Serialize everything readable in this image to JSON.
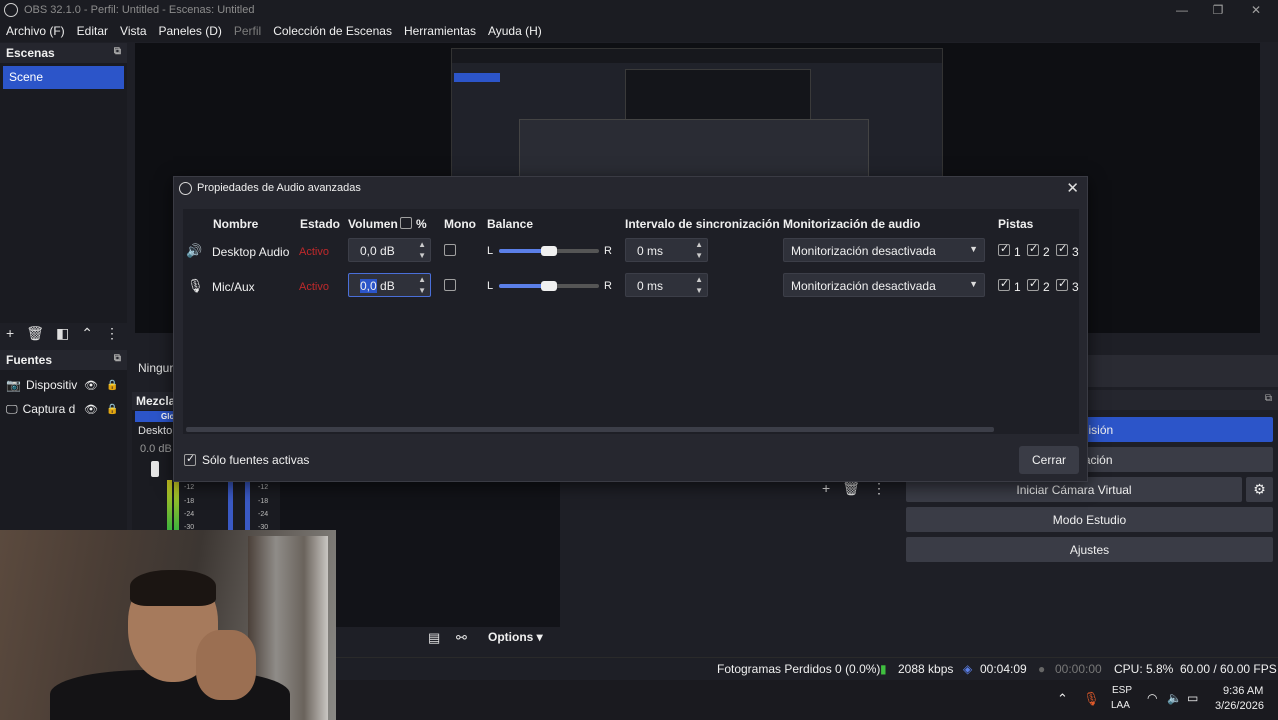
{
  "window": {
    "title": "OBS 32.1.0 - Perfil: Untitled - Escenas: Untitled",
    "controls": {
      "minimize": "—",
      "maximize": "❐",
      "close": "✕"
    }
  },
  "menu": {
    "items": [
      "Archivo (F)",
      "Editar",
      "Vista",
      "Paneles (D)",
      "Perfil",
      "Colección de Escenas",
      "Herramientas",
      "Ayuda (H)"
    ]
  },
  "scenes": {
    "title": "Escenas",
    "items": [
      "Scene"
    ]
  },
  "sources": {
    "title": "Fuentes",
    "items": [
      "Dispositiv",
      "Captura d"
    ]
  },
  "preview": {
    "transition_label": "Ningur"
  },
  "mixer": {
    "title": "Mezcla",
    "tab": "Glo",
    "channel": "Desktop",
    "db": "0.0 dB",
    "scale": [
      "-12",
      "-18",
      "-24",
      "-30"
    ]
  },
  "controls": {
    "stream": "nsmisión",
    "record": "rabación",
    "virtual_cam": "Iniciar Cámara Virtual",
    "studio": "Modo Estudio",
    "settings": "Ajustes"
  },
  "bottom_toolbar": {
    "options": "Options"
  },
  "status": {
    "dropped": "Fotogramas Perdidos 0 (0.0%)",
    "bitrate": "2088 kbps",
    "stream_time": "00:04:09",
    "rec_time": "00:00:00",
    "cpu": "CPU: 5.8%",
    "fps": "60.00 / 60.00 FPS",
    "bitrate_color": "#3fbf3f"
  },
  "taskbar": {
    "lang_top": "ESP",
    "lang_bottom": "LAA",
    "time": "9:36 AM",
    "date": "3/26/2026"
  },
  "dialog": {
    "title": "Propiedades de Audio avanzadas",
    "headers": {
      "name": "Nombre",
      "status": "Estado",
      "volume": "Volumen",
      "percent": "%",
      "mono": "Mono",
      "balance": "Balance",
      "sync": "Intervalo de sincronización",
      "monitoring": "Monitorización de audio",
      "tracks": "Pistas"
    },
    "rows": [
      {
        "icon": "speaker-icon",
        "name": "Desktop Audio",
        "status": "Activo",
        "volume": "0,0 dB",
        "mono": false,
        "balance_left": "L",
        "balance_right": "R",
        "balance": 0.5,
        "sync": "0 ms",
        "monitoring": "Monitorización desactivada",
        "tracks": [
          "1",
          "2",
          "3"
        ]
      },
      {
        "icon": "microphone-icon",
        "name": "Mic/Aux",
        "status": "Activo",
        "volume_selected": "0,0",
        "volume_unit": "dB",
        "mono": false,
        "balance_left": "L",
        "balance_right": "R",
        "balance": 0.5,
        "sync": "0 ms",
        "monitoring": "Monitorización desactivada",
        "tracks": [
          "1",
          "2",
          "3"
        ]
      }
    ],
    "only_active": "Sólo fuentes activas",
    "close_button": "Cerrar",
    "accent_color": "#2c55c9",
    "status_color": "#c0292b"
  }
}
